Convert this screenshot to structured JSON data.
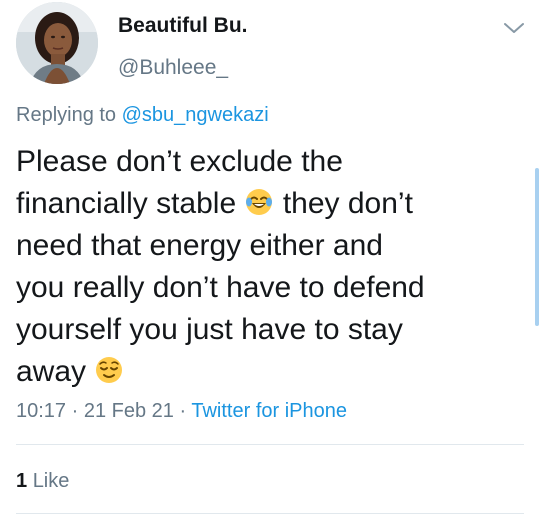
{
  "user": {
    "display_name": "Beautiful Bu.",
    "handle": "@Buhleee_"
  },
  "reply": {
    "prefix": "Replying to",
    "mention": "@sbu_ngwekazi"
  },
  "tweet": {
    "line1": "Please don’t exclude the",
    "line2a": "financially stable",
    "line2b": "they don’t",
    "line3": "need that energy either and",
    "line4": "you really don’t have to defend",
    "line5": "yourself you just have to stay",
    "line6": "away",
    "emojis": [
      "face-with-tears-of-joy-emoji",
      "relieved-face-emoji"
    ]
  },
  "meta": {
    "time": "10:17",
    "date": "21 Feb 21",
    "sep": "·",
    "source": "Twitter for iPhone"
  },
  "stats": {
    "like_count": "1",
    "like_label": "Like"
  },
  "colors": {
    "text": "#14171a",
    "muted": "#657786",
    "link": "#1b95e0",
    "divider": "#e1e8ed"
  },
  "icons": [
    "avatar",
    "chevron-down-icon"
  ]
}
